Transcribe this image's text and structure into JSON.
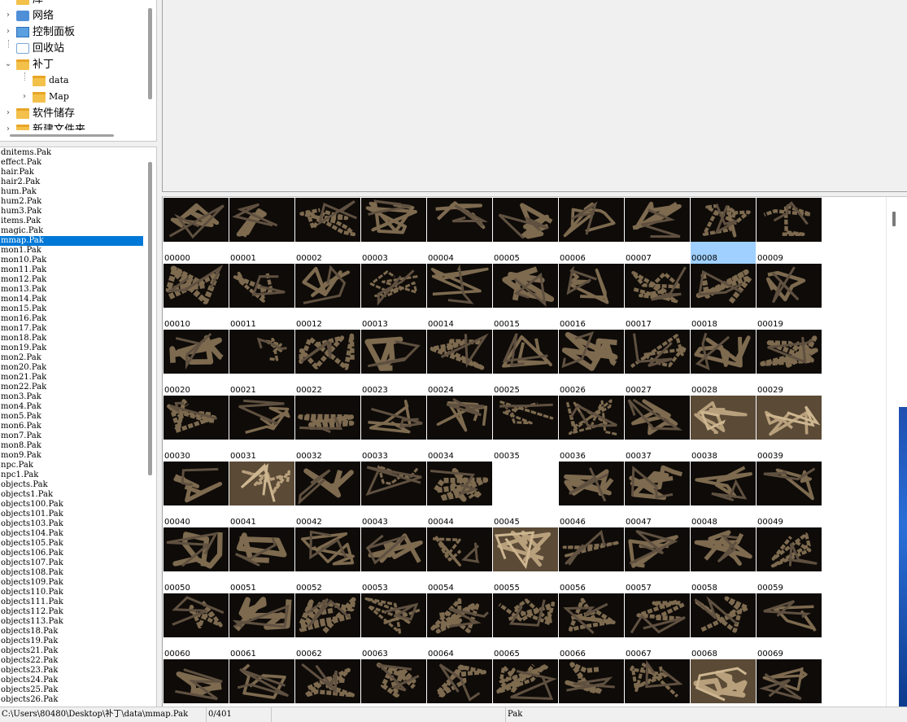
{
  "tree": {
    "items": [
      {
        "label": "库",
        "expander": "›",
        "icon": "folder",
        "depth": 0
      },
      {
        "label": "网络",
        "expander": "›",
        "icon": "network",
        "depth": 0
      },
      {
        "label": "控制面板",
        "expander": "›",
        "icon": "control-panel",
        "depth": 0
      },
      {
        "label": "回收站",
        "expander": "",
        "icon": "recycle-bin",
        "depth": 0
      },
      {
        "label": "补丁",
        "expander": "⌄",
        "icon": "folder",
        "depth": 0
      },
      {
        "label": "data",
        "expander": "",
        "icon": "folder",
        "depth": 1
      },
      {
        "label": "Map",
        "expander": "›",
        "icon": "folder",
        "depth": 1
      },
      {
        "label": "软件储存",
        "expander": "›",
        "icon": "folder",
        "depth": 0
      },
      {
        "label": "新建文件夹",
        "expander": "›",
        "icon": "folder",
        "depth": 0
      }
    ]
  },
  "files": {
    "selected_index": 9,
    "items": [
      "dnitems.Pak",
      "effect.Pak",
      "hair.Pak",
      "hair2.Pak",
      "hum.Pak",
      "hum2.Pak",
      "hum3.Pak",
      "items.Pak",
      "magic.Pak",
      "mmap.Pak",
      "mon1.Pak",
      "mon10.Pak",
      "mon11.Pak",
      "mon12.Pak",
      "mon13.Pak",
      "mon14.Pak",
      "mon15.Pak",
      "mon16.Pak",
      "mon17.Pak",
      "mon18.Pak",
      "mon19.Pak",
      "mon2.Pak",
      "mon20.Pak",
      "mon21.Pak",
      "mon22.Pak",
      "mon3.Pak",
      "mon4.Pak",
      "mon5.Pak",
      "mon6.Pak",
      "mon7.Pak",
      "mon8.Pak",
      "mon9.Pak",
      "npc.Pak",
      "npc1.Pak",
      "objects.Pak",
      "objects1.Pak",
      "objects100.Pak",
      "objects101.Pak",
      "objects103.Pak",
      "objects104.Pak",
      "objects105.Pak",
      "objects106.Pak",
      "objects107.Pak",
      "objects108.Pak",
      "objects109.Pak",
      "objects110.Pak",
      "objects111.Pak",
      "objects112.Pak",
      "objects113.Pak",
      "objects18.Pak",
      "objects19.Pak",
      "objects21.Pak",
      "objects22.Pak",
      "objects23.Pak",
      "objects24.Pak",
      "objects25.Pak",
      "objects26.Pak"
    ]
  },
  "grid": {
    "selected_index": 8,
    "empty_indices": [
      45
    ],
    "light_indices": [
      38,
      39,
      41,
      55,
      78
    ],
    "items": [
      "00000",
      "00001",
      "00002",
      "00003",
      "00004",
      "00005",
      "00006",
      "00007",
      "00008",
      "00009",
      "00010",
      "00011",
      "00012",
      "00013",
      "00014",
      "00015",
      "00016",
      "00017",
      "00018",
      "00019",
      "00020",
      "00021",
      "00022",
      "00023",
      "00024",
      "00025",
      "00026",
      "00027",
      "00028",
      "00029",
      "00030",
      "00031",
      "00032",
      "00033",
      "00034",
      "00035",
      "00036",
      "00037",
      "00038",
      "00039",
      "00040",
      "00041",
      "00042",
      "00043",
      "00044",
      "00045",
      "00046",
      "00047",
      "00048",
      "00049",
      "00050",
      "00051",
      "00052",
      "00053",
      "00054",
      "00055",
      "00056",
      "00057",
      "00058",
      "00059",
      "00060",
      "00061",
      "00062",
      "00063",
      "00064",
      "00065",
      "00066",
      "00067",
      "00068",
      "00069",
      "",
      "",
      "",
      "",
      "",
      "",
      "",
      "",
      "",
      ""
    ]
  },
  "status": {
    "path": "C:\\Users\\80480\\Desktop\\补丁\\data\\mmap.Pak",
    "count": "0/401",
    "type": "Pak"
  },
  "colors": {
    "selection": "#0078d7",
    "thumb_selection": "#9fd0ff",
    "map_dark": "#0e0b08",
    "map_path": "#7d6a4f"
  }
}
